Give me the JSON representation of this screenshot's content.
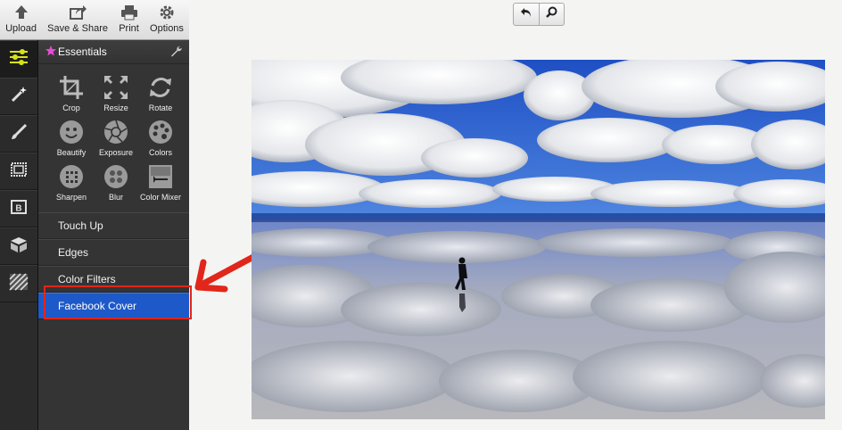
{
  "toolbar": {
    "upload": "Upload",
    "save_share": "Save & Share",
    "print": "Print",
    "options": "Options"
  },
  "panel": {
    "title": "Essentials",
    "tools": [
      "Crop",
      "Resize",
      "Rotate",
      "Beautify",
      "Exposure",
      "Colors",
      "Sharpen",
      "Blur",
      "Color Mixer"
    ],
    "sections": [
      "Touch Up",
      "Edges",
      "Color Filters",
      "Facebook Cover"
    ],
    "active_section": "Facebook Cover"
  },
  "colors": {
    "accent": "#1e59c9",
    "highlight": "#e1261a"
  },
  "icons": {
    "rail": [
      "adjustments-icon",
      "magic-wand-icon",
      "brush-icon",
      "frame-icon",
      "text-box-icon",
      "sticker-box-icon",
      "texture-icon"
    ],
    "controls": [
      "undo-icon",
      "zoom-icon"
    ]
  }
}
